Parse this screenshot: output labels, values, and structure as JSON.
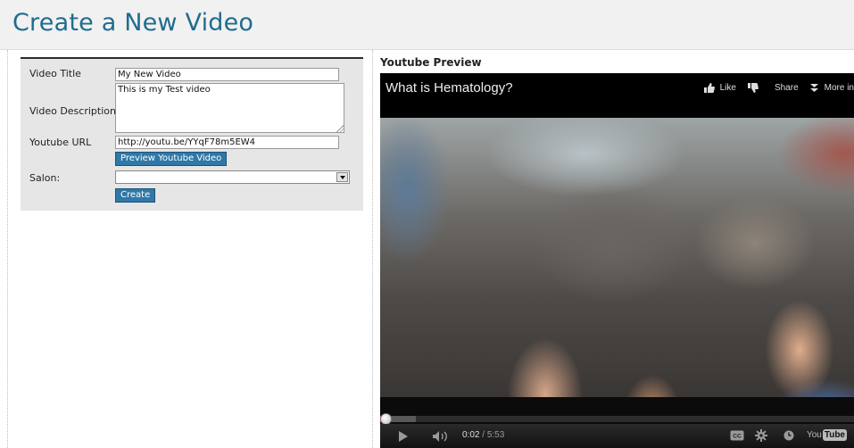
{
  "page": {
    "title": "Create a New Video"
  },
  "form": {
    "video_title_label": "Video Title",
    "video_title_value": "My New Video",
    "video_description_label": "Video Description",
    "video_description_value": "This is my Test video",
    "youtube_url_label": "Youtube URL",
    "youtube_url_value": "http://youtu.be/YYqF78m5EW4",
    "preview_button_label": "Preview Youtube Video",
    "salon_label": "Salon:",
    "salon_selected": "",
    "create_button_label": "Create"
  },
  "preview": {
    "heading": "Youtube Preview",
    "video_title": "What is Hematology?",
    "like_label": "Like",
    "share_label": "Share",
    "more_label": "More in",
    "current_time": "0:02",
    "time_separator": " / ",
    "duration": "5:53",
    "played_fraction": 0.006,
    "loaded_fraction": 0.075,
    "logo_you": "You",
    "logo_tube": "Tube"
  },
  "colors": {
    "title_blue": "#1f6c8e",
    "button_blue": "#2f78a8",
    "progress_red": "#c4302b"
  },
  "icons": {
    "like": "thumbs-up-icon",
    "dislike": "thumbs-down-icon",
    "more": "chevron-double-down-icon",
    "play": "play-icon",
    "volume": "volume-icon",
    "captions": "closed-captions-icon",
    "settings": "gear-icon",
    "watch_later": "clock-icon"
  }
}
